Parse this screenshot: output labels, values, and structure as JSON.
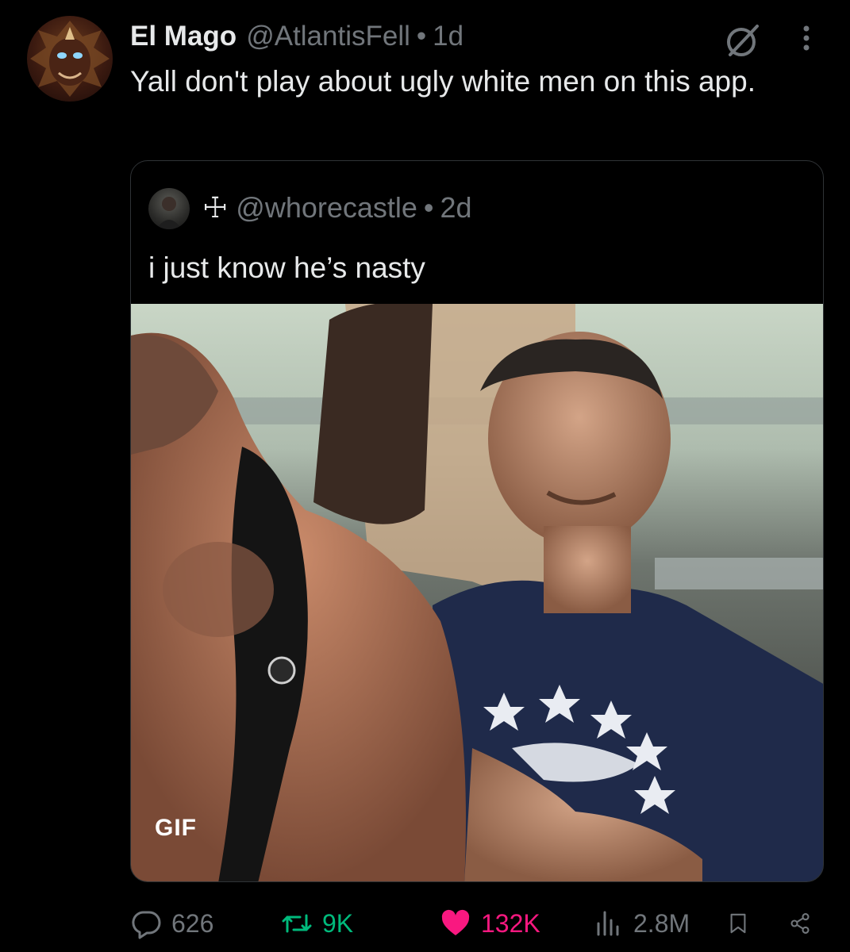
{
  "tweet": {
    "display_name": "El Mago",
    "handle": "@AtlantisFell",
    "separator": "•",
    "time": "1d",
    "text": "Yall don't play about ugly white men on this app."
  },
  "quoted": {
    "cross": "☩",
    "handle": "@whorecastle",
    "separator": "•",
    "time": "2d",
    "text": "i just know he’s nasty",
    "media_badge": "GIF"
  },
  "actions": {
    "replies": "626",
    "retweets": "9K",
    "likes": "132K",
    "views": "2.8M"
  },
  "colors": {
    "background": "#000000",
    "text_primary": "#e7e9ea",
    "text_secondary": "#71767b",
    "retweet": "#00ba7c",
    "like": "#f91880",
    "border": "#2f3336"
  },
  "icons": [
    "grok-icon",
    "more-icon",
    "reply-icon",
    "retweet-icon",
    "heart-icon",
    "views-icon",
    "bookmark-icon",
    "share-icon"
  ]
}
